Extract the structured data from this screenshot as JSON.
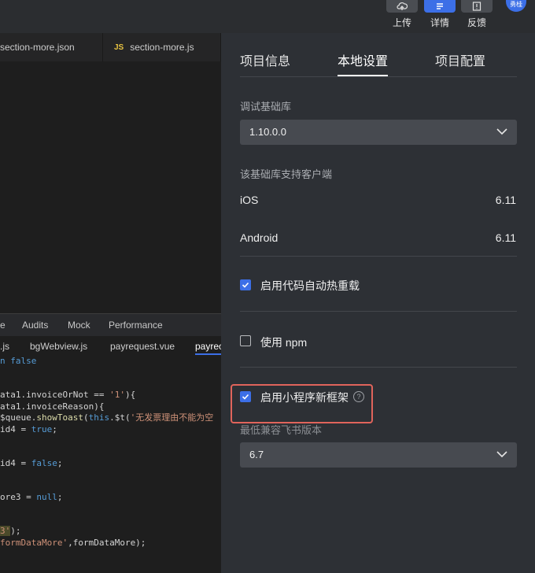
{
  "toolbar": {
    "upload_label": "上传",
    "details_label": "详情",
    "feedback_label": "反馈",
    "avatar_text": "勇桂",
    "accent": "#3c6fe7"
  },
  "editor": {
    "tabs": [
      {
        "label": "section-more.json"
      },
      {
        "badge": "JS",
        "label": "section-more.js"
      }
    ],
    "devtools_tabs": [
      "e",
      "Audits",
      "Mock",
      "Performance"
    ],
    "file_tabs": [
      ".js",
      "bgWebview.js",
      "payrequest.vue",
      "payrec"
    ]
  },
  "panel": {
    "tabs": [
      "项目信息",
      "本地设置",
      "项目配置"
    ],
    "active_tab": "本地设置",
    "base_lib_label": "调试基础库",
    "base_lib_value": "1.10.0.0",
    "clients_label": "该基础库支持客户端",
    "clients": [
      {
        "name": "iOS",
        "version": "6.11"
      },
      {
        "name": "Android",
        "version": "6.11"
      }
    ],
    "hot_reload_label": "启用代码自动热重载",
    "hot_reload_checked": true,
    "npm_label": "使用 npm",
    "npm_checked": false,
    "new_framework_label": "启用小程序新框架",
    "new_framework_checked": true,
    "help_glyph": "?",
    "min_version_label": "最低兼容飞书版本",
    "min_version_value": "6.7"
  }
}
